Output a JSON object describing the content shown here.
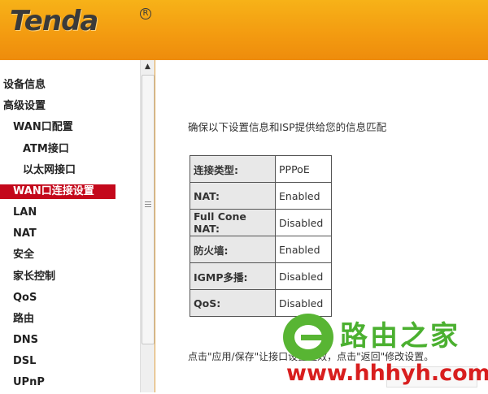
{
  "brand": {
    "name": "Tenda",
    "reg_mark": "R"
  },
  "sidebar": {
    "items": [
      {
        "label": "设备信息",
        "level": 0
      },
      {
        "label": "高级设置",
        "level": 0
      },
      {
        "label": "WAN口配置",
        "level": 1
      },
      {
        "label": "ATM接口",
        "level": 2
      },
      {
        "label": "以太网接口",
        "level": 2
      },
      {
        "label": "WAN口连接设置",
        "level": 1,
        "active": true
      },
      {
        "label": "LAN",
        "level": 1
      },
      {
        "label": "NAT",
        "level": 1
      },
      {
        "label": "安全",
        "level": 1
      },
      {
        "label": "家长控制",
        "level": 1
      },
      {
        "label": "QoS",
        "level": 1
      },
      {
        "label": "路由",
        "level": 1
      },
      {
        "label": "DNS",
        "level": 1
      },
      {
        "label": "DSL",
        "level": 1
      },
      {
        "label": "UPnP",
        "level": 1
      }
    ],
    "scroll_up_glyph": "▲"
  },
  "main": {
    "intro": "确保以下设置信息和ISP提供给您的信息匹配",
    "table": [
      {
        "key": "连接类型:",
        "value": "PPPoE"
      },
      {
        "key": "NAT:",
        "value": "Enabled"
      },
      {
        "key": "Full Cone NAT:",
        "value": "Disabled"
      },
      {
        "key": "防火墙:",
        "value": "Enabled"
      },
      {
        "key": "IGMP多播:",
        "value": "Disabled"
      },
      {
        "key": "QoS:",
        "value": "Disabled"
      }
    ],
    "footer_text": "点击\"应用/保存\"让接口设置生效，点击\"返回\"修改设置。"
  },
  "watermark": {
    "title": "路由之家",
    "url": "www.hhhyh.com"
  },
  "colors": {
    "header": "#f39a10",
    "active_nav": "#c4081b",
    "watermark_green": "#4bb030",
    "watermark_red": "#d81e1e"
  }
}
